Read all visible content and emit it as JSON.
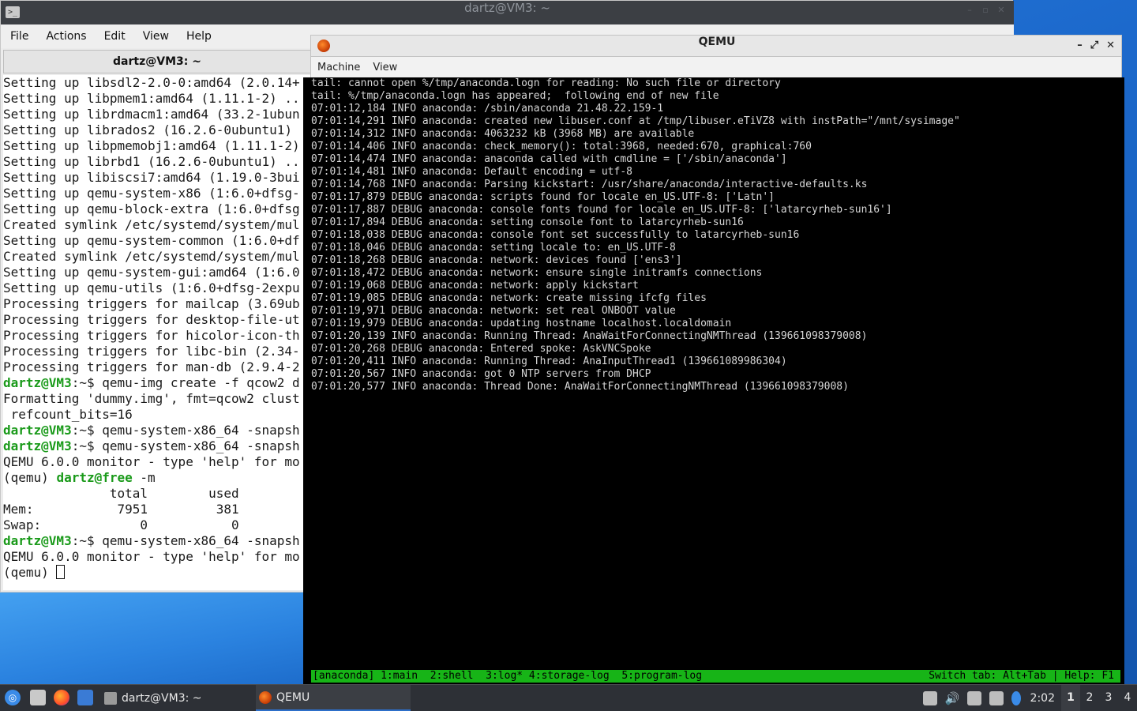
{
  "terminal": {
    "window_title": "dartz@VM3: ~",
    "menu": [
      "File",
      "Actions",
      "Edit",
      "View",
      "Help"
    ],
    "tab_title": "dartz@VM3: ~",
    "lines": [
      {
        "prompt": "",
        "text": "Setting up libsdl2-2.0-0:amd64 (2.0.14+"
      },
      {
        "prompt": "",
        "text": "Setting up libpmem1:amd64 (1.11.1-2) .."
      },
      {
        "prompt": "",
        "text": "Setting up librdmacm1:amd64 (33.2-1ubun"
      },
      {
        "prompt": "",
        "text": "Setting up librados2 (16.2.6-0ubuntu1) "
      },
      {
        "prompt": "",
        "text": "Setting up libpmemobj1:amd64 (1.11.1-2)"
      },
      {
        "prompt": "",
        "text": "Setting up librbd1 (16.2.6-0ubuntu1) .."
      },
      {
        "prompt": "",
        "text": "Setting up libiscsi7:amd64 (1.19.0-3bui"
      },
      {
        "prompt": "",
        "text": "Setting up qemu-system-x86 (1:6.0+dfsg-"
      },
      {
        "prompt": "",
        "text": "Setting up qemu-block-extra (1:6.0+dfsg"
      },
      {
        "prompt": "",
        "text": "Created symlink /etc/systemd/system/mul"
      },
      {
        "prompt": "",
        "text": "Setting up qemu-system-common (1:6.0+df"
      },
      {
        "prompt": "",
        "text": "Created symlink /etc/systemd/system/mul"
      },
      {
        "prompt": "",
        "text": "Setting up qemu-system-gui:amd64 (1:6.0"
      },
      {
        "prompt": "",
        "text": "Setting up qemu-utils (1:6.0+dfsg-2expu"
      },
      {
        "prompt": "",
        "text": "Processing triggers for mailcap (3.69ub"
      },
      {
        "prompt": "",
        "text": "Processing triggers for desktop-file-ut"
      },
      {
        "prompt": "",
        "text": "Processing triggers for hicolor-icon-th"
      },
      {
        "prompt": "",
        "text": "Processing triggers for libc-bin (2.34-"
      },
      {
        "prompt": "",
        "text": "Processing triggers for man-db (2.9.4-2"
      },
      {
        "prompt": "dartz@VM3",
        "text": ":~$ qemu-img create -f qcow2 d"
      },
      {
        "prompt": "",
        "text": "Formatting 'dummy.img', fmt=qcow2 clust"
      },
      {
        "prompt": "",
        "text": " refcount_bits=16"
      },
      {
        "prompt": "dartz@VM3",
        "text": ":~$ qemu-system-x86_64 -snapsh"
      },
      {
        "prompt": "dartz@VM3",
        "text": ":~$ qemu-system-x86_64 -snapsh"
      },
      {
        "prompt": "",
        "text": "QEMU 6.0.0 monitor - type 'help' for mo"
      },
      {
        "prompt": "dartz@free",
        "text": " -m",
        "pre": "(qemu) "
      },
      {
        "prompt": "",
        "text": "              total        used"
      },
      {
        "prompt": "",
        "text": "Mem:           7951         381"
      },
      {
        "prompt": "",
        "text": "Swap:             0           0"
      },
      {
        "prompt": "dartz@VM3",
        "text": ":~$ qemu-system-x86_64 -snapsh"
      },
      {
        "prompt": "",
        "text": "QEMU 6.0.0 monitor - type 'help' for mo"
      },
      {
        "prompt": "",
        "text": "(qemu) ",
        "cursor": true
      }
    ]
  },
  "qemu": {
    "window_title": "QEMU",
    "menu": [
      "Machine",
      "View"
    ],
    "log_lines": [
      "tail: cannot open %/tmp/anaconda.logn for reading: No such file or directory",
      "tail: %/tmp/anaconda.logn has appeared;  following end of new file",
      "07:01:12,184 INFO anaconda: /sbin/anaconda 21.48.22.159-1",
      "07:01:14,291 INFO anaconda: created new libuser.conf at /tmp/libuser.eTiVZ8 with instPath=\"/mnt/sysimage\"",
      "07:01:14,312 INFO anaconda: 4063232 kB (3968 MB) are available",
      "07:01:14,406 INFO anaconda: check_memory(): total:3968, needed:670, graphical:760",
      "07:01:14,474 INFO anaconda: anaconda called with cmdline = ['/sbin/anaconda']",
      "07:01:14,481 INFO anaconda: Default encoding = utf-8",
      "07:01:14,768 INFO anaconda: Parsing kickstart: /usr/share/anaconda/interactive-defaults.ks",
      "07:01:17,879 DEBUG anaconda: scripts found for locale en_US.UTF-8: ['Latn']",
      "07:01:17,887 DEBUG anaconda: console fonts found for locale en_US.UTF-8: ['latarcyrheb-sun16']",
      "07:01:17,894 DEBUG anaconda: setting console font to latarcyrheb-sun16",
      "07:01:18,038 DEBUG anaconda: console font set successfully to latarcyrheb-sun16",
      "07:01:18,046 DEBUG anaconda: setting locale to: en_US.UTF-8",
      "07:01:18,268 DEBUG anaconda: network: devices found ['ens3']",
      "07:01:18,472 DEBUG anaconda: network: ensure single initramfs connections",
      "07:01:19,068 DEBUG anaconda: network: apply kickstart",
      "07:01:19,085 DEBUG anaconda: network: create missing ifcfg files",
      "07:01:19,971 DEBUG anaconda: network: set real ONBOOT value",
      "07:01:19,979 DEBUG anaconda: updating hostname localhost.localdomain",
      "07:01:20,139 INFO anaconda: Running Thread: AnaWaitForConnectingNMThread (139661098379008)",
      "07:01:20,268 DEBUG anaconda: Entered spoke: AskVNCSpoke",
      "07:01:20,411 INFO anaconda: Running Thread: AnaInputThread1 (139661089986304)",
      "07:01:20,567 INFO anaconda: got 0 NTP servers from DHCP",
      "07:01:20,577 INFO anaconda: Thread Done: AnaWaitForConnectingNMThread (139661098379008)"
    ],
    "status_left": "[anaconda] 1:main  2:shell  3:log* 4:storage-log  5:program-log",
    "status_right": "Switch tab: Alt+Tab | Help: F1"
  },
  "taskbar": {
    "tasks": [
      {
        "label": "dartz@VM3: ~",
        "icon": "terminal-icon"
      },
      {
        "label": "QEMU",
        "icon": "qemu-icon"
      }
    ],
    "launchers": [
      "start-menu-icon",
      "file-manager-icon",
      "firefox-icon",
      "show-desktop-icon"
    ],
    "clock": "2:02",
    "workspaces": [
      "1",
      "2",
      "3",
      "4"
    ],
    "active_workspace": "1"
  }
}
